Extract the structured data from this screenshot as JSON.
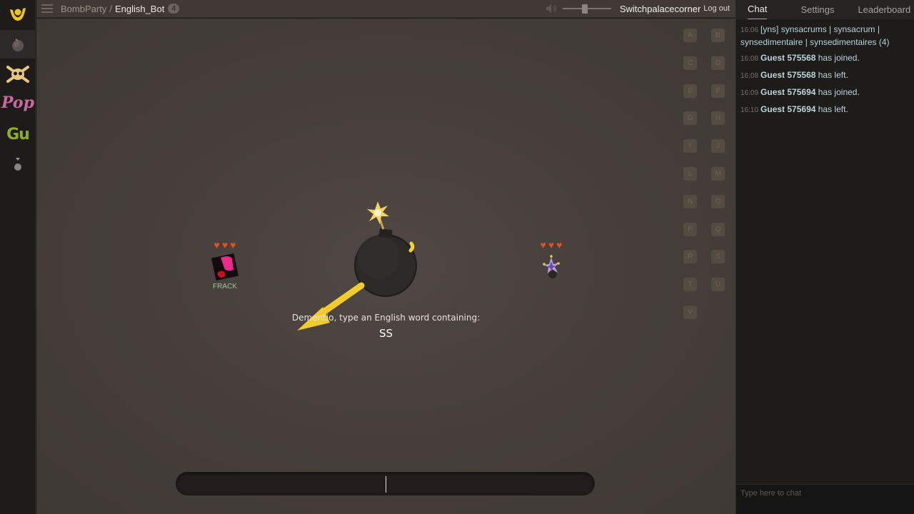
{
  "sidebar": {
    "items": [
      {
        "name": "home-logo",
        "label": ""
      },
      {
        "name": "bombparty",
        "label": ""
      },
      {
        "name": "masterpiece",
        "label": ""
      },
      {
        "name": "popsauce",
        "label": "Pop"
      },
      {
        "name": "gu",
        "label": "Gu"
      },
      {
        "name": "more",
        "label": ""
      }
    ]
  },
  "topbar": {
    "game": "BombParty",
    "separator": "/",
    "room": "English_Bot",
    "player_count": "4",
    "username": "Switchpalacecorner",
    "logout": "Log out",
    "volume_fraction": 0.45
  },
  "game": {
    "letters": [
      "A",
      "B",
      "C",
      "D",
      "E",
      "F",
      "G",
      "H",
      "I",
      "J",
      "L",
      "M",
      "N",
      "O",
      "P",
      "Q",
      "R",
      "S",
      "T",
      "U",
      "V"
    ],
    "players": [
      {
        "name": "FRACK",
        "lives": 3
      },
      {
        "name": "",
        "lives": 3
      }
    ],
    "prompt": "Dementio, type an English word containing:",
    "syllable": "SS",
    "input_value": ""
  },
  "right_panel": {
    "tabs": [
      {
        "label": "Chat",
        "active": true
      },
      {
        "label": "Settings",
        "active": false
      },
      {
        "label": "Leaderboard",
        "active": false
      }
    ],
    "messages": [
      {
        "time": "16:06",
        "who": "",
        "text": "[yns] synsacrums | synsacrum | synsedimentaire | synsedimentaires (4)"
      },
      {
        "time": "16:08",
        "who": "Guest 575568",
        "text": "has joined."
      },
      {
        "time": "16:08",
        "who": "Guest 575568",
        "text": "has left."
      },
      {
        "time": "16:09",
        "who": "Guest 575694",
        "text": "has joined."
      },
      {
        "time": "16:10",
        "who": "Guest 575694",
        "text": "has left."
      }
    ],
    "chat_placeholder": "Type here to chat"
  },
  "colors": {
    "accent_yellow": "#f0c419",
    "heart": "#e0521f",
    "pop": "#c86a9e",
    "gu": "#8fae1f"
  }
}
